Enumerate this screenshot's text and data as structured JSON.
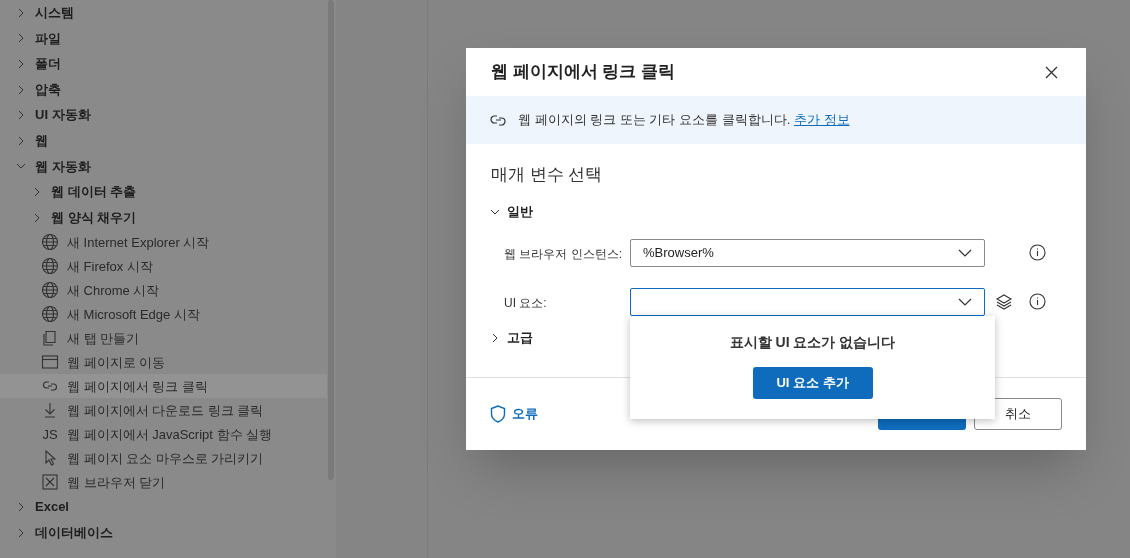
{
  "sidebar": {
    "items": [
      {
        "kind": "group",
        "label": "시스템",
        "expanded": false
      },
      {
        "kind": "group",
        "label": "파일",
        "expanded": false
      },
      {
        "kind": "group",
        "label": "폴더",
        "expanded": false
      },
      {
        "kind": "group",
        "label": "압축",
        "expanded": false
      },
      {
        "kind": "group",
        "label": "UI 자동화",
        "expanded": false
      },
      {
        "kind": "group",
        "label": "웹",
        "expanded": false
      },
      {
        "kind": "group",
        "label": "웹 자동화",
        "expanded": true,
        "children": [
          {
            "kind": "group",
            "label": "웹 데이터 추출",
            "expanded": false
          },
          {
            "kind": "group",
            "label": "웹 양식 채우기",
            "expanded": false
          },
          {
            "kind": "globe",
            "label": "새 Internet Explorer 시작",
            "selected": false
          },
          {
            "kind": "globe",
            "label": "새 Firefox 시작",
            "selected": false
          },
          {
            "kind": "globe",
            "label": "새 Chrome 시작",
            "selected": false
          },
          {
            "kind": "globe",
            "label": "새 Microsoft Edge 시작",
            "selected": false
          },
          {
            "kind": "tab",
            "label": "새 탭 만들기",
            "selected": false
          },
          {
            "kind": "window",
            "label": "웹 페이지로 이동",
            "selected": false
          },
          {
            "kind": "link",
            "label": "웹 페이지에서 링크 클릭",
            "selected": true
          },
          {
            "kind": "download",
            "label": "웹 페이지에서 다운로드 링크 클릭",
            "selected": false
          },
          {
            "kind": "script",
            "icon_text": "JS",
            "label": "웹 페이지에서 JavaScript 함수 실행",
            "selected": false
          },
          {
            "kind": "pointer",
            "label": "웹 페이지 요소 마우스로 가리키기",
            "selected": false
          },
          {
            "kind": "close",
            "label": "웹 브라우저 닫기",
            "selected": false
          }
        ]
      },
      {
        "kind": "group",
        "label": "Excel",
        "expanded": false
      },
      {
        "kind": "group",
        "label": "데이터베이스",
        "expanded": false
      }
    ]
  },
  "dialog": {
    "title": "웹 페이지에서 링크 클릭",
    "info": "웹 페이지의 링크 또는 기타 요소를 클릭합니다.",
    "info_link": "추가 정보",
    "heading": "매개 변수 선택",
    "sections": [
      {
        "label": "일반",
        "expanded": true
      },
      {
        "label": "고급",
        "expanded": false
      }
    ],
    "fields": [
      {
        "label": "웹 브라우저 인스턴스:",
        "value": "%Browser%",
        "focused": false,
        "layers": false
      },
      {
        "label": "UI 요소:",
        "focused": true,
        "layers": true
      }
    ],
    "error_label": "오류",
    "cancel": "취소",
    "popup": {
      "message": "표시할 UI 요소가 없습니다",
      "button": "UI 요소 추가"
    }
  }
}
